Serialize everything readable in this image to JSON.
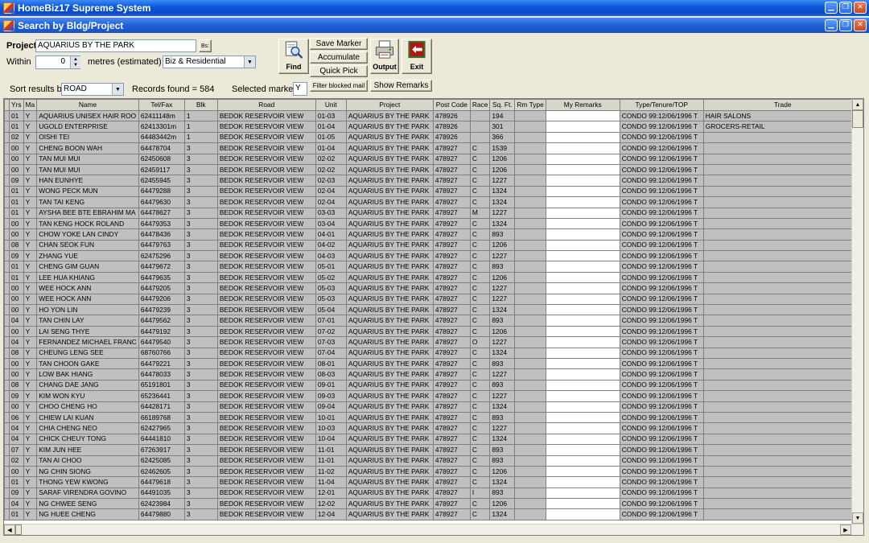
{
  "window": {
    "title": "HomeBiz17 Supreme System"
  },
  "child_window": {
    "title": "Search by Bldg/Project"
  },
  "search": {
    "project_label": "Project",
    "project_value": "AQUARIUS BY THE PARK",
    "browse_label": "Bs:",
    "within_label": "Within",
    "within_value": "0",
    "metres_label": "metres (estimated)",
    "category_value": "Biz & Residential",
    "sort_label": "Sort results by",
    "sort_value": "ROAD",
    "records_label": "Records found =",
    "records_count": "584",
    "marker_label": "Selected marker=",
    "marker_value": "Y"
  },
  "buttons": {
    "find": "Find",
    "save_marker": "Save Marker",
    "accumulate": "Accumulate",
    "quick_pick": "Quick Pick",
    "output": "Output",
    "exit": "Exit",
    "filter_blocked": "Filter blocked mail",
    "show_remarks": "Show Remarks"
  },
  "table": {
    "headers": [
      "Yrs",
      "Ma",
      "Name",
      "Tel/Fax",
      "Blk",
      "Road",
      "Unit",
      "Project",
      "Post Code",
      "Race",
      "Sq. Ft.",
      "Rm Type",
      "My Remarks",
      "Type/Tenure/TOP",
      "Trade"
    ],
    "rows": [
      [
        "01",
        "Y",
        "AQUARIUS UNISEX HAIR ROO",
        "62411148m",
        "1",
        "BEDOK RESERVOIR VIEW",
        "01-03",
        "AQUARIUS BY THE PARK",
        "478926",
        "",
        "194",
        "",
        "",
        "CONDO 99:12/06/1996 T",
        "HAIR SALONS"
      ],
      [
        "01",
        "Y",
        "UGOLD ENTERPRISE",
        "62413301m",
        "1",
        "BEDOK RESERVOIR VIEW",
        "01-04",
        "AQUARIUS BY THE PARK",
        "478926",
        "",
        "301",
        "",
        "",
        "CONDO 99:12/06/1996 T",
        "GROCERS-RETAIL"
      ],
      [
        "02",
        "Y",
        "OISHI TEI",
        "64483442m",
        "1",
        "BEDOK RESERVOIR VIEW",
        "01-05",
        "AQUARIUS BY THE PARK",
        "478926",
        "",
        "366",
        "",
        "",
        "CONDO 99:12/06/1996 T",
        ""
      ],
      [
        "00",
        "Y",
        "CHENG BOON WAH",
        "64478704",
        "3",
        "BEDOK RESERVOIR VIEW",
        "01-04",
        "AQUARIUS BY THE PARK",
        "478927",
        "C",
        "1539",
        "",
        "",
        "CONDO 99:12/06/1996 T",
        ""
      ],
      [
        "00",
        "Y",
        "TAN MUI MUI",
        "62450608",
        "3",
        "BEDOK RESERVOIR VIEW",
        "02-02",
        "AQUARIUS BY THE PARK",
        "478927",
        "C",
        "1206",
        "",
        "",
        "CONDO 99:12/06/1996 T",
        ""
      ],
      [
        "00",
        "Y",
        "TAN MUI MUI",
        "62459117",
        "3",
        "BEDOK RESERVOIR VIEW",
        "02-02",
        "AQUARIUS BY THE PARK",
        "478927",
        "C",
        "1206",
        "",
        "",
        "CONDO 99:12/06/1996 T",
        ""
      ],
      [
        "09",
        "Y",
        "HAN EUNHYE",
        "62455945",
        "3",
        "BEDOK RESERVOIR VIEW",
        "02-03",
        "AQUARIUS BY THE PARK",
        "478927",
        "C",
        "1227",
        "",
        "",
        "CONDO 99:12/06/1996 T",
        ""
      ],
      [
        "01",
        "Y",
        "WONG PECK MUN",
        "64479288",
        "3",
        "BEDOK RESERVOIR VIEW",
        "02-04",
        "AQUARIUS BY THE PARK",
        "478927",
        "C",
        "1324",
        "",
        "",
        "CONDO 99:12/06/1996 T",
        ""
      ],
      [
        "01",
        "Y",
        "TAN TAI KENG",
        "64479630",
        "3",
        "BEDOK RESERVOIR VIEW",
        "02-04",
        "AQUARIUS BY THE PARK",
        "478927",
        "C",
        "1324",
        "",
        "",
        "CONDO 99:12/06/1996 T",
        ""
      ],
      [
        "01",
        "Y",
        "AYSHA BEE BTE EBRAHIM MA",
        "64478627",
        "3",
        "BEDOK RESERVOIR VIEW",
        "03-03",
        "AQUARIUS BY THE PARK",
        "478927",
        "M",
        "1227",
        "",
        "",
        "CONDO 99:12/06/1996 T",
        ""
      ],
      [
        "00",
        "Y",
        "TAN KENG HOCK ROLAND",
        "64479353",
        "3",
        "BEDOK RESERVOIR VIEW",
        "03-04",
        "AQUARIUS BY THE PARK",
        "478927",
        "C",
        "1324",
        "",
        "",
        "CONDO 99:12/06/1996 T",
        ""
      ],
      [
        "00",
        "Y",
        "CHOW YOKE LAN CINDY",
        "64478436",
        "3",
        "BEDOK RESERVOIR VIEW",
        "04-01",
        "AQUARIUS BY THE PARK",
        "478927",
        "C",
        "893",
        "",
        "",
        "CONDO 99:12/06/1996 T",
        ""
      ],
      [
        "08",
        "Y",
        "CHAN SEOK FUN",
        "64479763",
        "3",
        "BEDOK RESERVOIR VIEW",
        "04-02",
        "AQUARIUS BY THE PARK",
        "478927",
        "C",
        "1206",
        "",
        "",
        "CONDO 99:12/06/1996 T",
        ""
      ],
      [
        "09",
        "Y",
        "ZHANG YUE",
        "62475296",
        "3",
        "BEDOK RESERVOIR VIEW",
        "04-03",
        "AQUARIUS BY THE PARK",
        "478927",
        "C",
        "1227",
        "",
        "",
        "CONDO 99:12/06/1996 T",
        ""
      ],
      [
        "01",
        "Y",
        "CHENG GIM GUAN",
        "64479672",
        "3",
        "BEDOK RESERVOIR VIEW",
        "05-01",
        "AQUARIUS BY THE PARK",
        "478927",
        "C",
        "893",
        "",
        "",
        "CONDO 99:12/06/1996 T",
        ""
      ],
      [
        "01",
        "Y",
        "LEE HUA KHIANG",
        "64479635",
        "3",
        "BEDOK RESERVOIR VIEW",
        "05-02",
        "AQUARIUS BY THE PARK",
        "478927",
        "C",
        "1206",
        "",
        "",
        "CONDO 99:12/06/1996 T",
        ""
      ],
      [
        "00",
        "Y",
        "WEE HOCK ANN",
        "64479205",
        "3",
        "BEDOK RESERVOIR VIEW",
        "05-03",
        "AQUARIUS BY THE PARK",
        "478927",
        "C",
        "1227",
        "",
        "",
        "CONDO 99:12/06/1996 T",
        ""
      ],
      [
        "00",
        "Y",
        "WEE HOCK ANN",
        "64479206",
        "3",
        "BEDOK RESERVOIR VIEW",
        "05-03",
        "AQUARIUS BY THE PARK",
        "478927",
        "C",
        "1227",
        "",
        "",
        "CONDO 99:12/06/1996 T",
        ""
      ],
      [
        "00",
        "Y",
        "HO YON LIN",
        "64479239",
        "3",
        "BEDOK RESERVOIR VIEW",
        "05-04",
        "AQUARIUS BY THE PARK",
        "478927",
        "C",
        "1324",
        "",
        "",
        "CONDO 99:12/06/1996 T",
        ""
      ],
      [
        "04",
        "Y",
        "TAN CHIN LAY",
        "64479562",
        "3",
        "BEDOK RESERVOIR VIEW",
        "07-01",
        "AQUARIUS BY THE PARK",
        "478927",
        "C",
        "893",
        "",
        "",
        "CONDO 99:12/06/1996 T",
        ""
      ],
      [
        "00",
        "Y",
        "LAI SENG THYE",
        "64479192",
        "3",
        "BEDOK RESERVOIR VIEW",
        "07-02",
        "AQUARIUS BY THE PARK",
        "478927",
        "C",
        "1206",
        "",
        "",
        "CONDO 99:12/06/1996 T",
        ""
      ],
      [
        "04",
        "Y",
        "FERNANDEZ MICHAEL FRANC",
        "64479540",
        "3",
        "BEDOK RESERVOIR VIEW",
        "07-03",
        "AQUARIUS BY THE PARK",
        "478927",
        "O",
        "1227",
        "",
        "",
        "CONDO 99:12/06/1996 T",
        ""
      ],
      [
        "08",
        "Y",
        "CHEUNG LENG SEE",
        "68760766",
        "3",
        "BEDOK RESERVOIR VIEW",
        "07-04",
        "AQUARIUS BY THE PARK",
        "478927",
        "C",
        "1324",
        "",
        "",
        "CONDO 99:12/06/1996 T",
        ""
      ],
      [
        "00",
        "Y",
        "TAN CHOON GAKE",
        "64479221",
        "3",
        "BEDOK RESERVOIR VIEW",
        "08-01",
        "AQUARIUS BY THE PARK",
        "478927",
        "C",
        "893",
        "",
        "",
        "CONDO 99:12/06/1996 T",
        ""
      ],
      [
        "00",
        "Y",
        "LOW BAK HIANG",
        "64478033",
        "3",
        "BEDOK RESERVOIR VIEW",
        "08-03",
        "AQUARIUS BY THE PARK",
        "478927",
        "C",
        "1227",
        "",
        "",
        "CONDO 99:12/06/1996 T",
        ""
      ],
      [
        "08",
        "Y",
        "CHANG DAE JANG",
        "65191801",
        "3",
        "BEDOK RESERVOIR VIEW",
        "09-01",
        "AQUARIUS BY THE PARK",
        "478927",
        "C",
        "893",
        "",
        "",
        "CONDO 99:12/06/1996 T",
        ""
      ],
      [
        "09",
        "Y",
        "KIM WON KYU",
        "65236441",
        "3",
        "BEDOK RESERVOIR VIEW",
        "09-03",
        "AQUARIUS BY THE PARK",
        "478927",
        "C",
        "1227",
        "",
        "",
        "CONDO 99:12/06/1996 T",
        ""
      ],
      [
        "00",
        "Y",
        "CHOO CHENG HO",
        "64428171",
        "3",
        "BEDOK RESERVOIR VIEW",
        "09-04",
        "AQUARIUS BY THE PARK",
        "478927",
        "C",
        "1324",
        "",
        "",
        "CONDO 99:12/06/1996 T",
        ""
      ],
      [
        "06",
        "Y",
        "CHIEW LAI KUAN",
        "66189768",
        "3",
        "BEDOK RESERVOIR VIEW",
        "10-01",
        "AQUARIUS BY THE PARK",
        "478927",
        "C",
        "893",
        "",
        "",
        "CONDO 99:12/06/1996 T",
        ""
      ],
      [
        "04",
        "Y",
        "CHIA CHENG NEO",
        "62427965",
        "3",
        "BEDOK RESERVOIR VIEW",
        "10-03",
        "AQUARIUS BY THE PARK",
        "478927",
        "C",
        "1227",
        "",
        "",
        "CONDO 99:12/06/1996 T",
        ""
      ],
      [
        "04",
        "Y",
        "CHICK CHEUY TONG",
        "64441810",
        "3",
        "BEDOK RESERVOIR VIEW",
        "10-04",
        "AQUARIUS BY THE PARK",
        "478927",
        "C",
        "1324",
        "",
        "",
        "CONDO 99:12/06/1996 T",
        ""
      ],
      [
        "07",
        "Y",
        "KIM JUN HEE",
        "67263917",
        "3",
        "BEDOK RESERVOIR VIEW",
        "11-01",
        "AQUARIUS BY THE PARK",
        "478927",
        "C",
        "893",
        "",
        "",
        "CONDO 99:12/06/1996 T",
        ""
      ],
      [
        "02",
        "Y",
        "TAN AI CHOO",
        "62425085",
        "3",
        "BEDOK RESERVOIR VIEW",
        "11-01",
        "AQUARIUS BY THE PARK",
        "478927",
        "C",
        "893",
        "",
        "",
        "CONDO 99:12/06/1996 T",
        ""
      ],
      [
        "00",
        "Y",
        "NG CHIN SIONG",
        "62462605",
        "3",
        "BEDOK RESERVOIR VIEW",
        "11-02",
        "AQUARIUS BY THE PARK",
        "478927",
        "C",
        "1206",
        "",
        "",
        "CONDO 99:12/06/1996 T",
        ""
      ],
      [
        "01",
        "Y",
        "THONG YEW KWONG",
        "64479618",
        "3",
        "BEDOK RESERVOIR VIEW",
        "11-04",
        "AQUARIUS BY THE PARK",
        "478927",
        "C",
        "1324",
        "",
        "",
        "CONDO 99:12/06/1996 T",
        ""
      ],
      [
        "09",
        "Y",
        "SARAF VIRENDRA GOVINO",
        "64491035",
        "3",
        "BEDOK RESERVOIR VIEW",
        "12-01",
        "AQUARIUS BY THE PARK",
        "478927",
        "I",
        "893",
        "",
        "",
        "CONDO 99:12/06/1996 T",
        ""
      ],
      [
        "04",
        "Y",
        "NG CHWEE SENG",
        "62423984",
        "3",
        "BEDOK RESERVOIR VIEW",
        "12-02",
        "AQUARIUS BY THE PARK",
        "478927",
        "C",
        "1206",
        "",
        "",
        "CONDO 99:12/06/1996 T",
        ""
      ],
      [
        "01",
        "Y",
        "NG HUEE CHENG",
        "64479880",
        "3",
        "BEDOK RESERVOIR VIEW",
        "12-04",
        "AQUARIUS BY THE PARK",
        "478927",
        "C",
        "1324",
        "",
        "",
        "CONDO 99:12/06/1996 T",
        ""
      ]
    ]
  }
}
